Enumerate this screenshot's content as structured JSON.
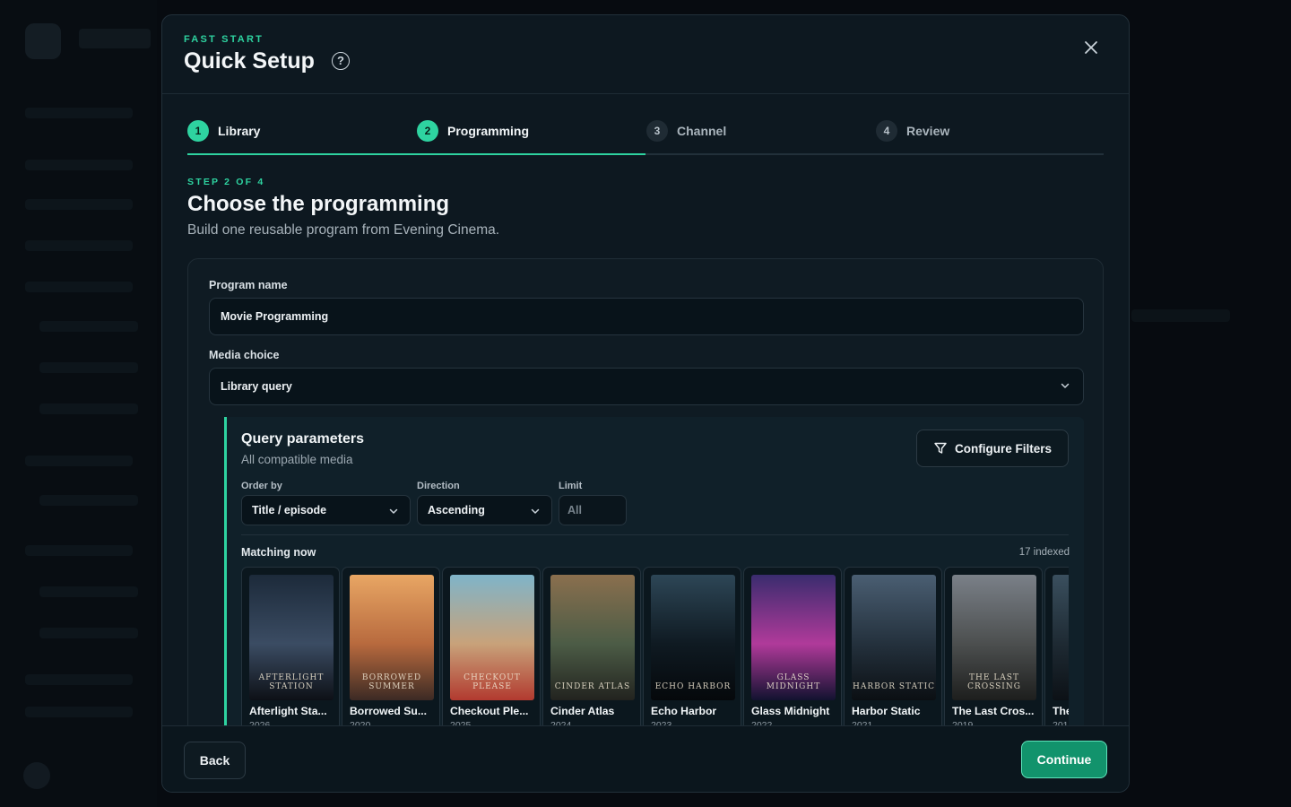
{
  "modal": {
    "eyebrow": "FAST START",
    "title": "Quick Setup"
  },
  "stepper": {
    "steps": [
      {
        "num": "1",
        "label": "Library",
        "state": "done"
      },
      {
        "num": "2",
        "label": "Programming",
        "state": "active"
      },
      {
        "num": "3",
        "label": "Channel",
        "state": "pending"
      },
      {
        "num": "4",
        "label": "Review",
        "state": "pending"
      }
    ],
    "progress_fraction": 0.5
  },
  "step": {
    "eyebrow": "STEP 2 OF 4",
    "title": "Choose the programming",
    "subtitle": "Build one reusable program from Evening Cinema."
  },
  "form": {
    "program_name_label": "Program name",
    "program_name_value": "Movie Programming",
    "media_choice_label": "Media choice",
    "media_choice_value": "Library query"
  },
  "query": {
    "title": "Query parameters",
    "subtitle": "All compatible media",
    "configure_filters_label": "Configure Filters",
    "order_by_label": "Order by",
    "order_by_value": "Title / episode",
    "direction_label": "Direction",
    "direction_value": "Ascending",
    "limit_label": "Limit",
    "limit_placeholder": "All",
    "matching_label": "Matching now",
    "indexed_count": "17 indexed"
  },
  "posters": [
    {
      "title": "Afterlight Sta...",
      "year": "2026",
      "art_text": "AFTERLIGHT STATION",
      "colors": [
        "#1c2a3a",
        "#3b4c63",
        "#0d1016"
      ]
    },
    {
      "title": "Borrowed Su...",
      "year": "2020",
      "art_text": "BORROWED SUMMER",
      "colors": [
        "#e8a664",
        "#b86a3e",
        "#3c2a24"
      ]
    },
    {
      "title": "Checkout Ple...",
      "year": "2025",
      "art_text": "CHECKOUT PLEASE",
      "colors": [
        "#7fb4c9",
        "#c8a27a",
        "#b23a2f"
      ]
    },
    {
      "title": "Cinder Atlas",
      "year": "2024",
      "art_text": "CINDER ATLAS",
      "colors": [
        "#8a6f4e",
        "#4c5c46",
        "#22231f"
      ]
    },
    {
      "title": "Echo Harbor",
      "year": "2023",
      "art_text": "ECHO HARBOR",
      "colors": [
        "#2d4656",
        "#0f1a22",
        "#05080b"
      ]
    },
    {
      "title": "Glass Midnight",
      "year": "2022",
      "art_text": "GLASS MIDNIGHT",
      "colors": [
        "#3a2c6e",
        "#b03a9a",
        "#121230"
      ]
    },
    {
      "title": "Harbor Static",
      "year": "2021",
      "art_text": "HARBOR STATIC",
      "colors": [
        "#4a5e72",
        "#24313d",
        "#0b0f13"
      ]
    },
    {
      "title": "The Last Cros...",
      "year": "2019",
      "art_text": "THE LAST CROSSING",
      "colors": [
        "#7a8088",
        "#4c4f4f",
        "#1d1e1d"
      ]
    },
    {
      "title": "The",
      "year": "201",
      "art_text": "",
      "colors": [
        "#3a4f5e",
        "#1e2a33",
        "#0c1116"
      ]
    }
  ],
  "footer": {
    "back_label": "Back",
    "continue_label": "Continue"
  },
  "colors": {
    "accent": "#2ed3a0",
    "primary_button": "#12936c"
  }
}
